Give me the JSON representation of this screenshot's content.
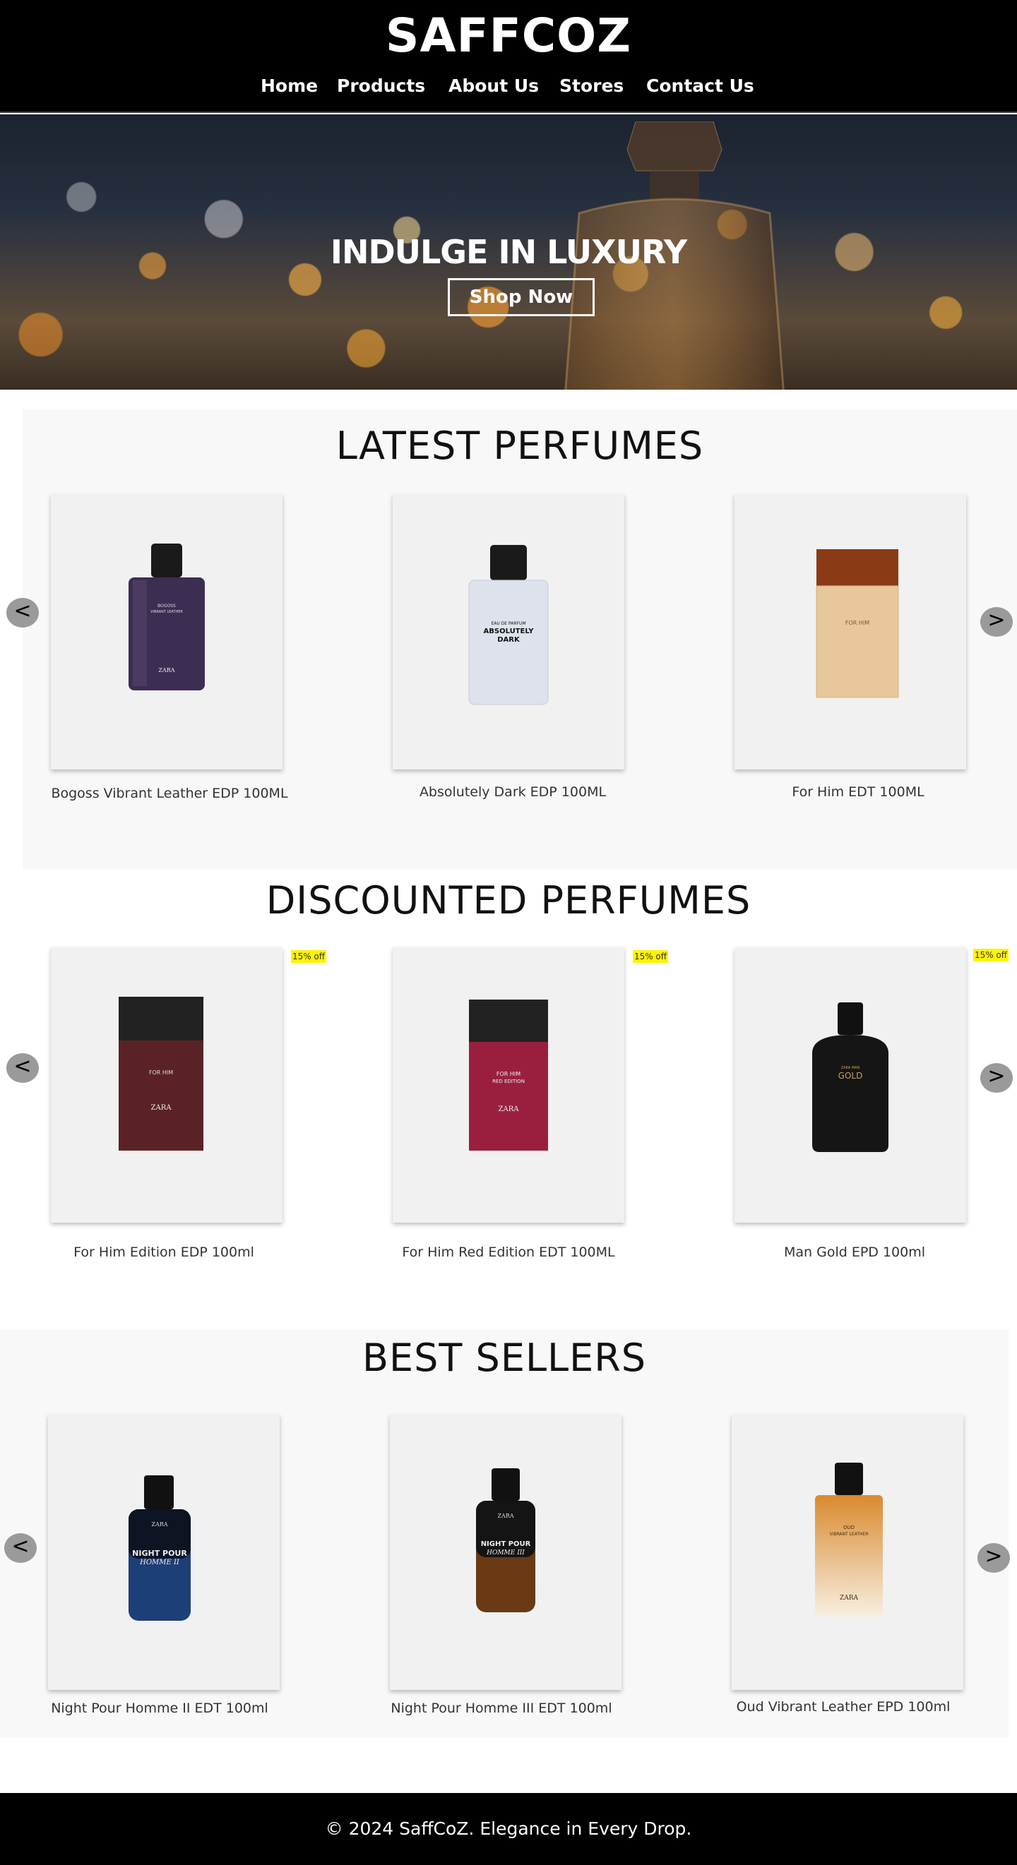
{
  "header": {
    "brand": "SAFFCOZ",
    "nav": [
      "Home",
      "Products",
      "About Us",
      "Stores",
      "Contact Us"
    ]
  },
  "hero": {
    "title": "INDULGE IN LUXURY",
    "cta": "Shop Now"
  },
  "arrows": {
    "prev": "<",
    "next": ">"
  },
  "latest": {
    "title": "LATEST PERFUMES",
    "products": [
      {
        "name": "Bogoss Vibrant Leather EDP 100ML",
        "label": "BOGOSS\nVIBRANT LEATHER"
      },
      {
        "name": "Absolutely Dark EDP 100ML",
        "label": "ABSOLUTELY\nDARK"
      },
      {
        "name": "For Him EDT 100ML",
        "label": "FOR HIM"
      }
    ]
  },
  "discounted": {
    "title": "DISCOUNTED PERFUMES",
    "products": [
      {
        "name": "For Him Edition EDP 100ml",
        "badge": "15% off",
        "label": "FOR HIM"
      },
      {
        "name": "For Him Red Edition EDT 100ML",
        "badge": "15% off",
        "label": "FOR HIM\nRED EDITION"
      },
      {
        "name": "Man Gold EPD 100ml",
        "badge": "15% off",
        "label": "GOLD"
      }
    ]
  },
  "bestsellers": {
    "title": "BEST SELLERS",
    "products": [
      {
        "name": "Night Pour Homme II EDT 100ml",
        "label": "NIGHT POUR\nHOMME II"
      },
      {
        "name": "Night Pour Homme III EDT 100ml",
        "label": "NIGHT POUR\nHOMME III"
      },
      {
        "name": "Oud Vibrant Leather EPD 100ml",
        "label": "OUD\nVIBRANT LEATHER"
      }
    ]
  },
  "brand_mark": "ZARA",
  "footer": {
    "text": "© 2024 SaffCoZ. Elegance in Every Drop."
  },
  "colors": {
    "header_bg": "#000000",
    "section_bg": "#f8f8f8",
    "card_bg": "#f1f1f1",
    "badge_bg": "#fff200",
    "arrow_bg": "#9a9a9a"
  }
}
